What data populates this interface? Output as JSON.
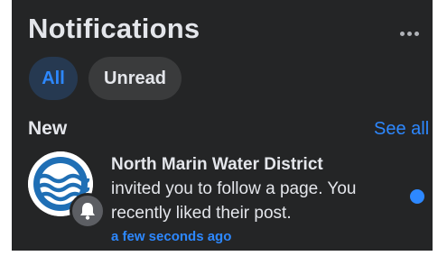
{
  "header": {
    "title": "Notifications",
    "more_icon": "more-horizontal-icon"
  },
  "tabs": [
    {
      "label": "All",
      "selected": true
    },
    {
      "label": "Unread",
      "selected": false
    }
  ],
  "section": {
    "label": "New",
    "see_all_label": "See all"
  },
  "notifications": [
    {
      "sender": "North Marin Water District",
      "message": "invited you to follow a page. You recently liked their post.",
      "time": "a few seconds ago",
      "badge_icon": "bell-icon",
      "unread": true
    }
  ],
  "colors": {
    "background": "#242526",
    "accent": "#2d88ff",
    "selected_tab_bg": "#263951",
    "tab_bg": "#3a3b3c",
    "text_primary": "#e4e6eb"
  }
}
